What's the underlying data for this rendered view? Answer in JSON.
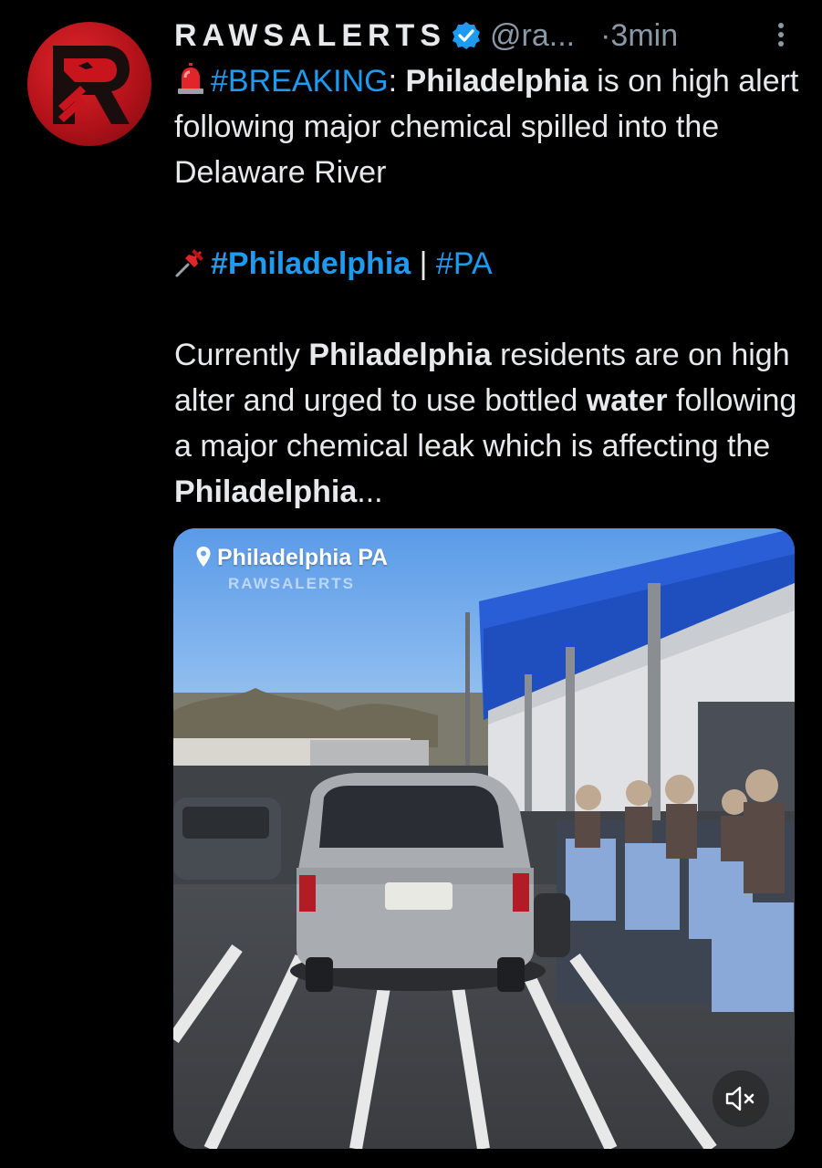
{
  "tweet": {
    "author_name": "RAWSALERTS",
    "handle": "@ra...",
    "time_separator": "·",
    "time": "3min",
    "line1_hashtag": "#BREAKING",
    "line1_colon": ":",
    "line1_bold": "Philadelphia",
    "line1_rest": " is on high alert following major chemical spilled into the Delaware River",
    "tag_line_1": "#Philadelphia",
    "tag_sep": " | ",
    "tag_line_2": "#PA",
    "para_start": "Currently ",
    "para_bold1": "Philadelphia",
    "para_mid1": " residents are on high alter and urged to use bottled ",
    "para_bold2": "water",
    "para_mid2": " following a major chemical leak which is affecting the ",
    "para_bold3": "Philadelphia",
    "para_end": "..."
  },
  "media": {
    "location_label": "Philadelphia PA",
    "watermark": "RAWSALERTS",
    "mute_icon": "speaker-muted-icon"
  },
  "colors": {
    "background": "#000000",
    "text": "#e7e9ea",
    "secondary": "#8b98a5",
    "link": "#1d9bf0",
    "brand_red": "#c8141c"
  }
}
